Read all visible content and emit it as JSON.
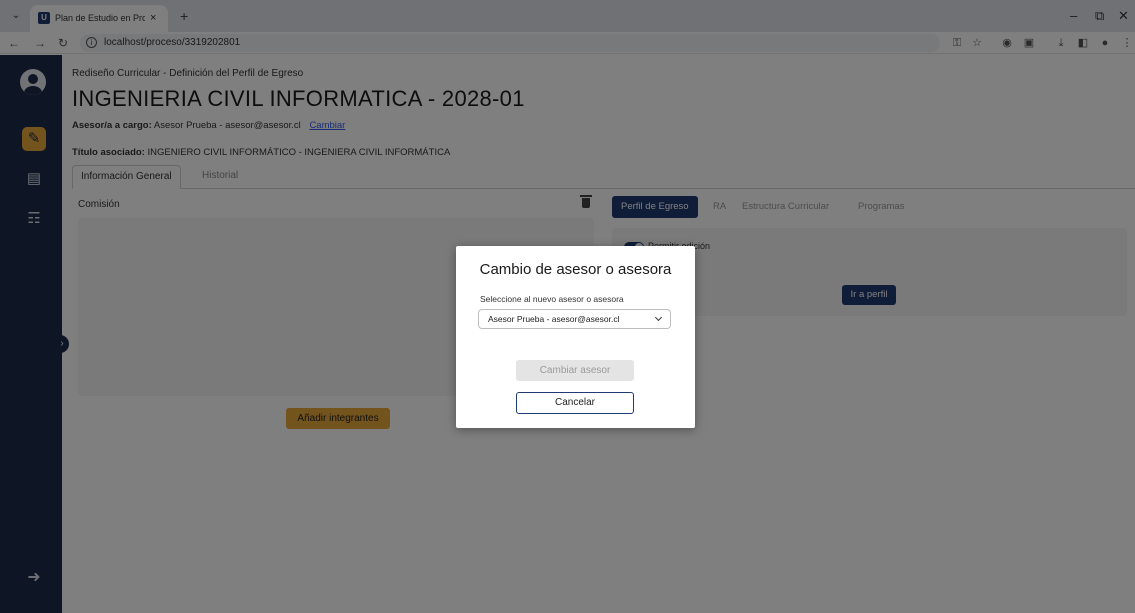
{
  "browser": {
    "tab_title": "Plan de Estudio en Proceso - Si",
    "url": "localhost/proceso/3319202801",
    "new_tab": "+",
    "tab_close": "×"
  },
  "app": {
    "subtitle": "Rediseño Curricular - Definición del Perfil de Egreso",
    "title": "INGENIERIA CIVIL INFORMATICA - 2028-01",
    "advisor_label": "Asesor/a a cargo:",
    "advisor_value": "Asesor Prueba - asesor@asesor.cl",
    "advisor_change_link": "Cambiar",
    "degree_label": "Título asociado:",
    "degree_value": "INGENIERO CIVIL INFORMÁTICO - INGENIERA CIVIL INFORMÁTICA",
    "tabs": [
      "Información General",
      "Historial"
    ],
    "left_panel": {
      "title": "Comisión",
      "add_button": "Añadir integrantes"
    },
    "right_panel": {
      "tabs": [
        "Perfil de Egreso",
        "RA",
        "Estructura Curricular",
        "Programas"
      ],
      "toggle_label": "Permitir edición",
      "go_button": "Ir a perfil"
    }
  },
  "modal": {
    "title": "Cambio de asesor o asesora",
    "select_label": "Seleccione al nuevo asesor o asesora",
    "select_value": "Asesor Prueba - asesor@asesor.cl",
    "change_button": "Cambiar asesor",
    "cancel_button": "Cancelar"
  },
  "colors": {
    "sidebar": "#1c2a4a",
    "accent": "#e8a93a",
    "primary": "#1f3b73",
    "link": "#2f5bea"
  }
}
